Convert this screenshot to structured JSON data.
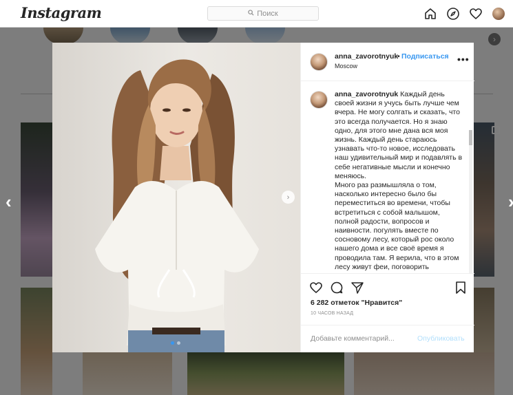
{
  "header": {
    "logo": "Instagram",
    "search_placeholder": "Поиск"
  },
  "post": {
    "username": "anna_zavorotnyuk",
    "separator": "•",
    "follow_label": "Подписаться",
    "location": "Moscow",
    "more_label": "•••",
    "caption": "Каждый день своей жизни я учусь быть лучше чем вчера. Не могу солгать и сказать, что это всегда получается. Но я знаю одно, для этого мне дана вся моя жизнь. Каждый день стараюсь узнавать что-то новое, исследовать наш удивительный мир и подавлять в себе негативные мысли и конечно меняюсь.\nМного раз размышляла о том, насколько интересно было бы переместиться во времени, чтобы встретиться с собой малышом, полной радости, вопросов и наивности. погулять вместе по сосновому лесу, который рос около нашего дома и все своё время я проводила там. Я верила, что в этом лесу живут феи, поговорить",
    "likes": "6 282 отметок \"Нравится\"",
    "time": "10 ЧАСОВ НАЗАД",
    "comment_placeholder": "Добавьте комментарий...",
    "publish_label": "Опубликовать",
    "carousel": {
      "count": 2,
      "active_index": 0
    }
  },
  "colors": {
    "accent": "#3897f0",
    "publish_disabled": "#b2dffc",
    "muted_text": "#8e8e8e",
    "border": "#efefef"
  }
}
